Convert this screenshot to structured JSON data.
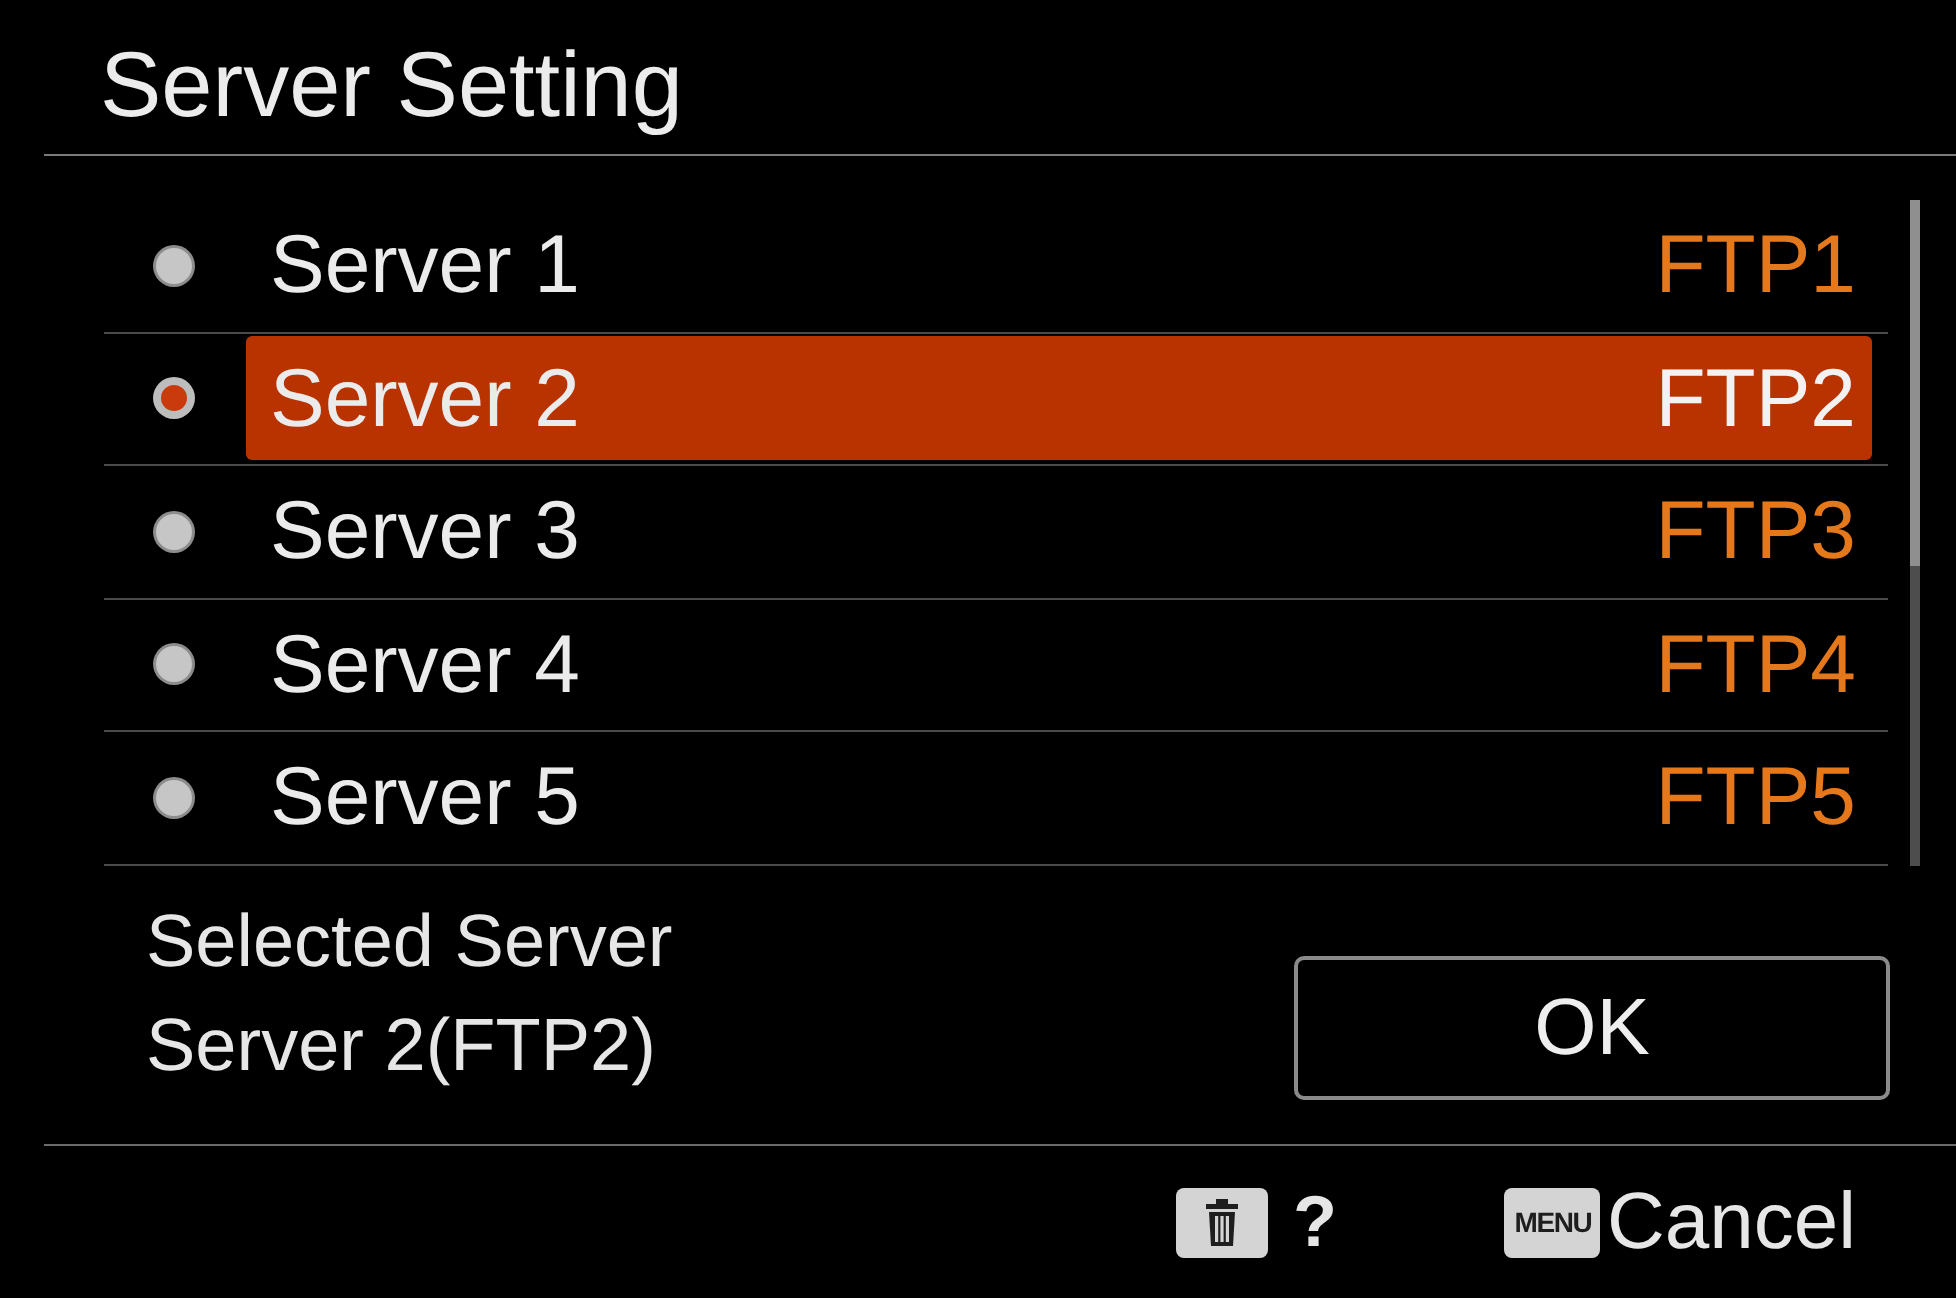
{
  "title": "Server Setting",
  "servers": [
    {
      "name": "Server 1",
      "profile": "FTP1",
      "selected": false
    },
    {
      "name": "Server 2",
      "profile": "FTP2",
      "selected": true
    },
    {
      "name": "Server 3",
      "profile": "FTP3",
      "selected": false
    },
    {
      "name": "Server 4",
      "profile": "FTP4",
      "selected": false
    },
    {
      "name": "Server 5",
      "profile": "FTP5",
      "selected": false
    }
  ],
  "selection": {
    "label": "Selected Server",
    "value": "Server 2(FTP2)"
  },
  "ok_button": "OK",
  "footer": {
    "help": "?",
    "menu_key": "MENU",
    "cancel": "Cancel"
  }
}
